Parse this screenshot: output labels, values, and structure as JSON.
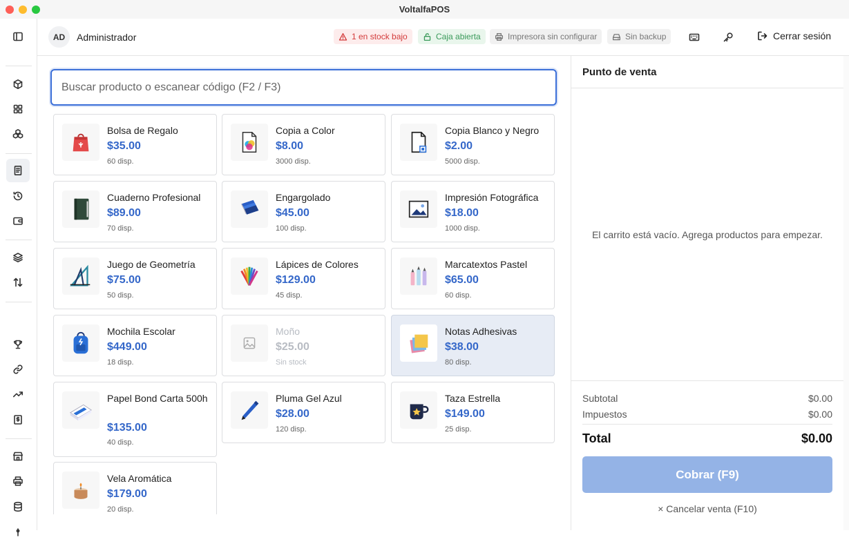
{
  "window": {
    "title": "VoltalfaPOS"
  },
  "header": {
    "avatar_initials": "AD",
    "user_name": "Administrador",
    "badges": {
      "low_stock": "1 en stock bajo",
      "register": "Caja abierta",
      "printer": "Impresora sin configurar",
      "backup": "Sin backup"
    },
    "logout_label": "Cerrar sesión"
  },
  "search": {
    "placeholder": "Buscar producto o escanear código (F2 / F3)"
  },
  "products": [
    {
      "name": "Bolsa de Regalo",
      "price": "$35.00",
      "stock": "60 disp.",
      "icon": "gift-bag-icon"
    },
    {
      "name": "Copia a Color",
      "price": "$8.00",
      "stock": "3000 disp.",
      "icon": "color-copy-icon"
    },
    {
      "name": "Copia Blanco y Negro",
      "price": "$2.00",
      "stock": "5000 disp.",
      "icon": "document-copy-icon"
    },
    {
      "name": "Cuaderno Profesional",
      "price": "$89.00",
      "stock": "70 disp.",
      "icon": "notebook-icon"
    },
    {
      "name": "Engargolado",
      "price": "$45.00",
      "stock": "100 disp.",
      "icon": "spiral-binding-icon"
    },
    {
      "name": "Impresión Fotográfica",
      "price": "$18.00",
      "stock": "1000 disp.",
      "icon": "photo-print-icon"
    },
    {
      "name": "Juego de Geometría",
      "price": "$75.00",
      "stock": "50 disp.",
      "icon": "geometry-set-icon"
    },
    {
      "name": "Lápices de Colores",
      "price": "$129.00",
      "stock": "45 disp.",
      "icon": "colored-pencils-icon"
    },
    {
      "name": "Marcatextos Pastel",
      "price": "$65.00",
      "stock": "60 disp.",
      "icon": "highlighters-icon"
    },
    {
      "name": "Mochila Escolar",
      "price": "$449.00",
      "stock": "18 disp.",
      "icon": "backpack-icon"
    },
    {
      "name": "Moño",
      "price": "$25.00",
      "stock": "Sin stock",
      "icon": "image-placeholder-icon"
    },
    {
      "name": "Notas Adhesivas",
      "price": "$38.00",
      "stock": "80 disp.",
      "icon": "sticky-notes-icon"
    },
    {
      "name": "Papel Bond Carta 500h",
      "price": "$135.00",
      "stock": "40 disp.",
      "icon": "paper-ream-icon"
    },
    {
      "name": "Pluma Gel Azul",
      "price": "$28.00",
      "stock": "120 disp.",
      "icon": "gel-pen-icon"
    },
    {
      "name": "Taza Estrella",
      "price": "$149.00",
      "stock": "25 disp.",
      "icon": "star-mug-icon"
    },
    {
      "name": "Vela Aromática",
      "price": "$179.00",
      "stock": "20 disp.",
      "icon": "candle-icon"
    }
  ],
  "cart": {
    "title": "Punto de venta",
    "empty_message": "El carrito está vacío. Agrega productos para empezar.",
    "subtotal_label": "Subtotal",
    "subtotal_value": "$0.00",
    "tax_label": "Impuestos",
    "tax_value": "$0.00",
    "total_label": "Total",
    "total_value": "$0.00",
    "charge_button": "Cobrar (F9)",
    "cancel_button": "Cancelar venta (F10)"
  },
  "colors": {
    "accent": "#3467c9",
    "focus_border": "#3b6fd8",
    "charge_button": "#94b3e6",
    "warning": "#d33a3a",
    "ok": "#3a9a5a"
  }
}
